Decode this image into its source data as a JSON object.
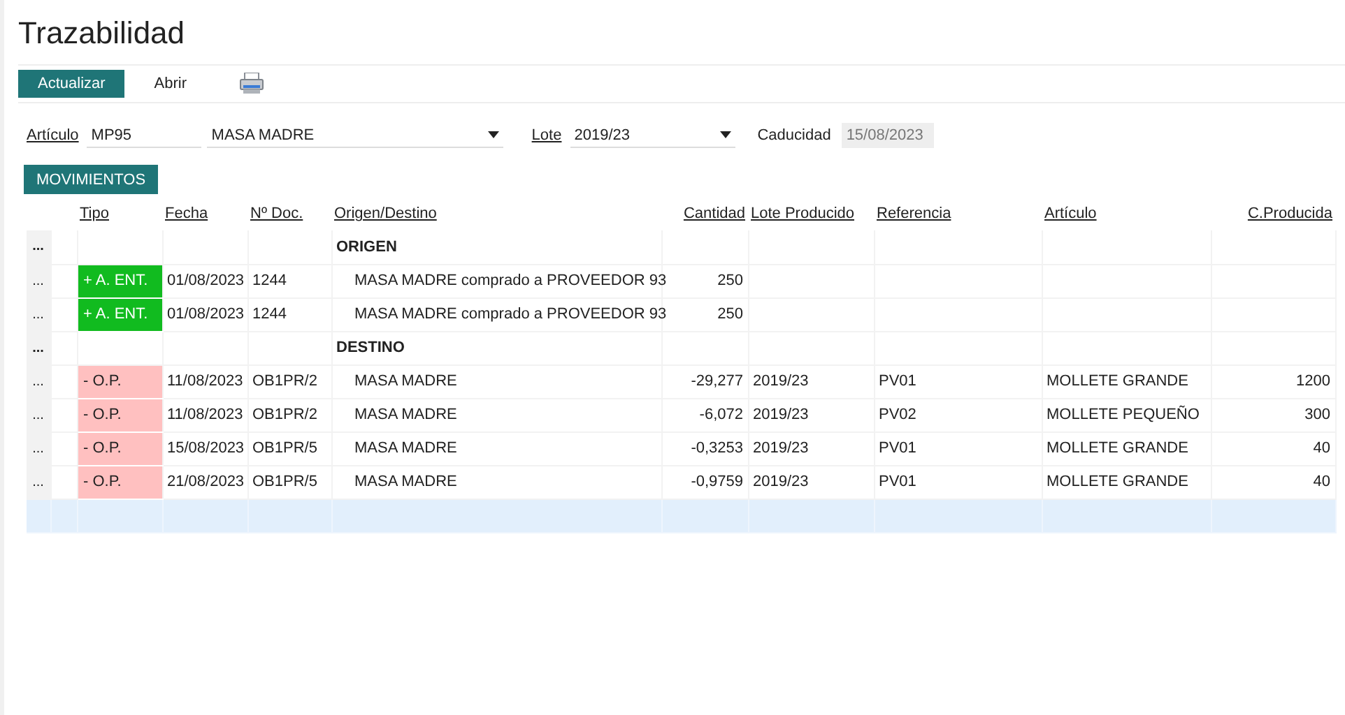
{
  "page_title": "Trazabilidad",
  "toolbar": {
    "buttons": [
      {
        "label": "Actualizar",
        "kind": "primary"
      },
      {
        "label": "Abrir",
        "kind": "plain"
      },
      {
        "kind": "print"
      }
    ]
  },
  "filters": {
    "articulo": {
      "label": "Artículo",
      "code": "MP95",
      "name": "MASA MADRE"
    },
    "lote": {
      "label": "Lote",
      "value": "2019/23"
    },
    "caducidad": {
      "label": "Caducidad",
      "value": "15/08/2023",
      "disabled": true
    }
  },
  "section_button": "MOVIMIENTOS",
  "table": {
    "columns": [
      "Tipo",
      "Fecha",
      "Nº Doc.",
      "Origen/Destino",
      "Cantidad",
      "Lote Producido",
      "Referencia",
      "Artículo",
      "C.Producida"
    ],
    "rows": [
      {
        "kind": "group",
        "handle": "...",
        "label": "ORIGEN"
      },
      {
        "kind": "line",
        "handle": "...",
        "tipo": "+ A. ENT.",
        "color": "#11bb1f",
        "fecha": "01/08/2023",
        "doc": "1244",
        "origen": "MASA MADRE comprado a PROVEEDOR 93",
        "cantidad": "250"
      },
      {
        "kind": "line",
        "handle": "...",
        "tipo": "+ A. ENT.",
        "color": "#11bb1f",
        "fecha": "01/08/2023",
        "doc": "1244",
        "origen": "MASA MADRE comprado a PROVEEDOR 93",
        "cantidad": "250"
      },
      {
        "kind": "group",
        "handle": "...",
        "label": "DESTINO"
      },
      {
        "kind": "line",
        "handle": "...",
        "tipo": "- O.P.",
        "color": "#ffc0c0",
        "fecha": "11/08/2023",
        "doc": "OB1PR/2",
        "origen": "MASA MADRE",
        "cantidad": "-29,277",
        "lote": "2019/23",
        "referencia": "PV01",
        "articulo": "MOLLETE GRANDE",
        "producida": "1200"
      },
      {
        "kind": "line",
        "handle": "...",
        "tipo": "- O.P.",
        "color": "#ffc0c0",
        "fecha": "11/08/2023",
        "doc": "OB1PR/2",
        "origen": "MASA MADRE",
        "cantidad": "-6,072",
        "lote": "2019/23",
        "referencia": "PV02",
        "articulo": "MOLLETE PEQUEÑO",
        "producida": "300"
      },
      {
        "kind": "line",
        "handle": "...",
        "tipo": "- O.P.",
        "color": "#ffc0c0",
        "fecha": "15/08/2023",
        "doc": "OB1PR/5",
        "origen": "MASA MADRE",
        "cantidad": "-0,3253",
        "lote": "2019/23",
        "referencia": "PV01",
        "articulo": "MOLLETE GRANDE",
        "producida": "40"
      },
      {
        "kind": "line",
        "handle": "...",
        "tipo": "- O.P.",
        "color": "#ffc0c0",
        "fecha": "21/08/2023",
        "doc": "OB1PR/5",
        "origen": "MASA MADRE",
        "cantidad": "-0,9759",
        "lote": "2019/23",
        "referencia": "PV01",
        "articulo": "MOLLETE GRANDE",
        "producida": "40"
      },
      {
        "kind": "new"
      }
    ]
  }
}
